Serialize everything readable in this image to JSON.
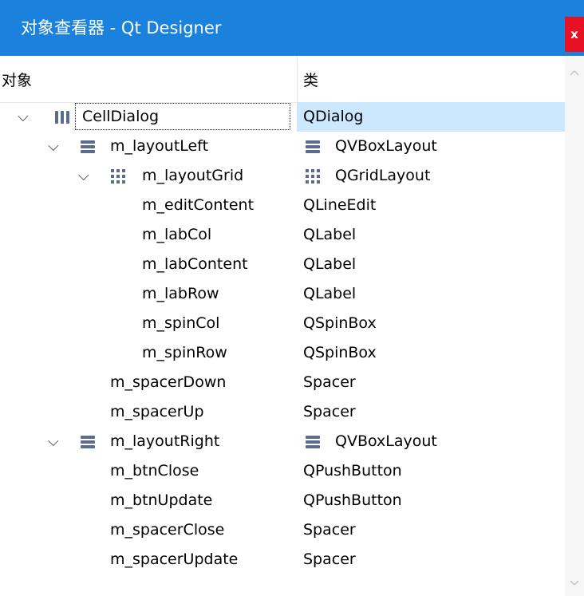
{
  "window": {
    "title": "对象查看器 - Qt Designer",
    "close_label": "x"
  },
  "header": {
    "col_object": "对象",
    "col_class": "类"
  },
  "rows": [
    {
      "name": "CellDialog",
      "class": "QDialog",
      "icon": "hbox-layout-icon",
      "class_icon": "",
      "expanded": true,
      "selected": true
    },
    {
      "name": "m_layoutLeft",
      "class": "QVBoxLayout",
      "icon": "vbox-layout-icon",
      "class_icon": "vbox-layout-icon",
      "expanded": true
    },
    {
      "name": "m_layoutGrid",
      "class": "QGridLayout",
      "icon": "grid-layout-icon",
      "class_icon": "grid-layout-icon",
      "expanded": true
    },
    {
      "name": "m_editContent",
      "class": "QLineEdit"
    },
    {
      "name": "m_labCol",
      "class": "QLabel"
    },
    {
      "name": "m_labContent",
      "class": "QLabel"
    },
    {
      "name": "m_labRow",
      "class": "QLabel"
    },
    {
      "name": "m_spinCol",
      "class": "QSpinBox"
    },
    {
      "name": "m_spinRow",
      "class": "QSpinBox"
    },
    {
      "name": "m_spacerDown",
      "class": "Spacer"
    },
    {
      "name": "m_spacerUp",
      "class": "Spacer"
    },
    {
      "name": "m_layoutRight",
      "class": "QVBoxLayout",
      "icon": "vbox-layout-icon",
      "class_icon": "vbox-layout-icon",
      "expanded": true
    },
    {
      "name": "m_btnClose",
      "class": "QPushButton"
    },
    {
      "name": "m_btnUpdate",
      "class": "QPushButton"
    },
    {
      "name": "m_spacerClose",
      "class": "Spacer"
    },
    {
      "name": "m_spacerUpdate",
      "class": "Spacer"
    }
  ],
  "colors": {
    "titlebar": "#1a82dc",
    "selection": "#cce8ff",
    "close": "#e81123",
    "icon": "#5a6b8c"
  }
}
